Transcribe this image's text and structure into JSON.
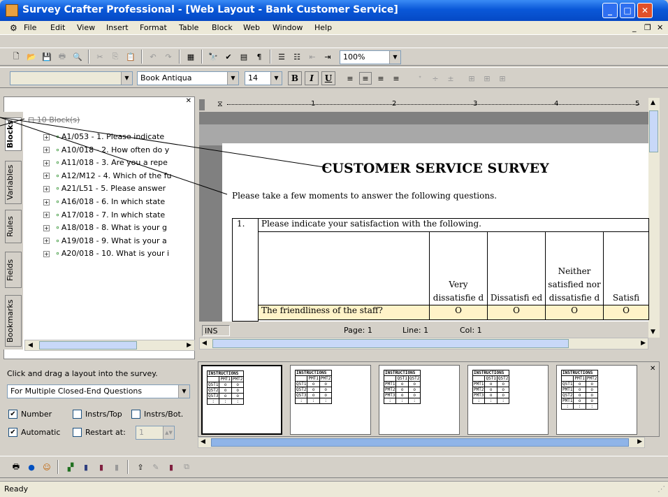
{
  "window": {
    "title": "Survey Crafter Professional - [Web Layout - Bank Customer Service]"
  },
  "menu": [
    "File",
    "Edit",
    "View",
    "Insert",
    "Format",
    "Table",
    "Block",
    "Web",
    "Window",
    "Help"
  ],
  "toolbar": {
    "zoom": "100%",
    "font": "Book Antiqua",
    "size": "14"
  },
  "tabs": [
    "Blocks",
    "Variables",
    "Rules",
    "Fields",
    "Bookmarks"
  ],
  "tree": {
    "root": "10 Block(s)",
    "items": [
      "A1/053 - 1. Please indicate",
      "A10/018 - 2. How often do y",
      "A11/018 - 3. Are you a repe",
      "A12/M12 - 4. Which of the fu",
      "A21/L51 - 5. Please answer",
      "A16/018 - 6. In which state",
      "A17/018 - 7. In which state",
      "A18/018 - 8. What is your g",
      "A19/018 - 9. What is your a",
      "A20/018 - 10. What is your i"
    ]
  },
  "ruler": [
    "1",
    "2",
    "3",
    "4",
    "5"
  ],
  "document": {
    "heading": "CUSTOMER SERVICE SURVEY",
    "intro": "Please take a few moments to answer the following questions.",
    "q_num": "1.",
    "q_text": "Please indicate your satisfaction with the following.",
    "columns": [
      "Very dissatisfie d",
      "Dissatisfi ed",
      "Neither satisfied nor dissatisfie d",
      "Satisfi"
    ],
    "row_label": "The friendliness of the staff?",
    "radio": "O"
  },
  "status_doc": {
    "mode": "INS",
    "page": "Page: 1",
    "line": "Line: 1",
    "col": "Col: 1"
  },
  "bottom": {
    "hint": "Click and drag a layout into the survey.",
    "layout": "For Multiple Closed-End Questions",
    "number": "Number",
    "instrs_top": "Instrs/Top",
    "instrs_bot": "Instrs/Bot.",
    "automatic": "Automatic",
    "restart": "Restart at:",
    "restart_val": "1"
  },
  "thumbs": [
    {
      "h": [
        "PMT1",
        "PMT2"
      ],
      "r": [
        "QST1",
        "QST2",
        "QST3"
      ]
    },
    {
      "h": [
        "PMT1",
        "PMT2"
      ],
      "r": [
        "QST1",
        "QST2",
        "QST3"
      ]
    },
    {
      "h": [
        "QST1",
        "QST2"
      ],
      "r": [
        "PMT1",
        "PMT2",
        "PMT3"
      ]
    },
    {
      "h": [
        "QST1",
        "QST2"
      ],
      "r": [
        "PMT1",
        "PMT2",
        "PMT3"
      ]
    },
    {
      "h": [
        "PMT1",
        "PMT2"
      ],
      "r": [
        "QST1",
        "PMT1",
        "QST2",
        "PMT1"
      ]
    }
  ],
  "instructions_label": "INSTRUCTIONS",
  "statusbar": {
    "text": "Ready"
  }
}
